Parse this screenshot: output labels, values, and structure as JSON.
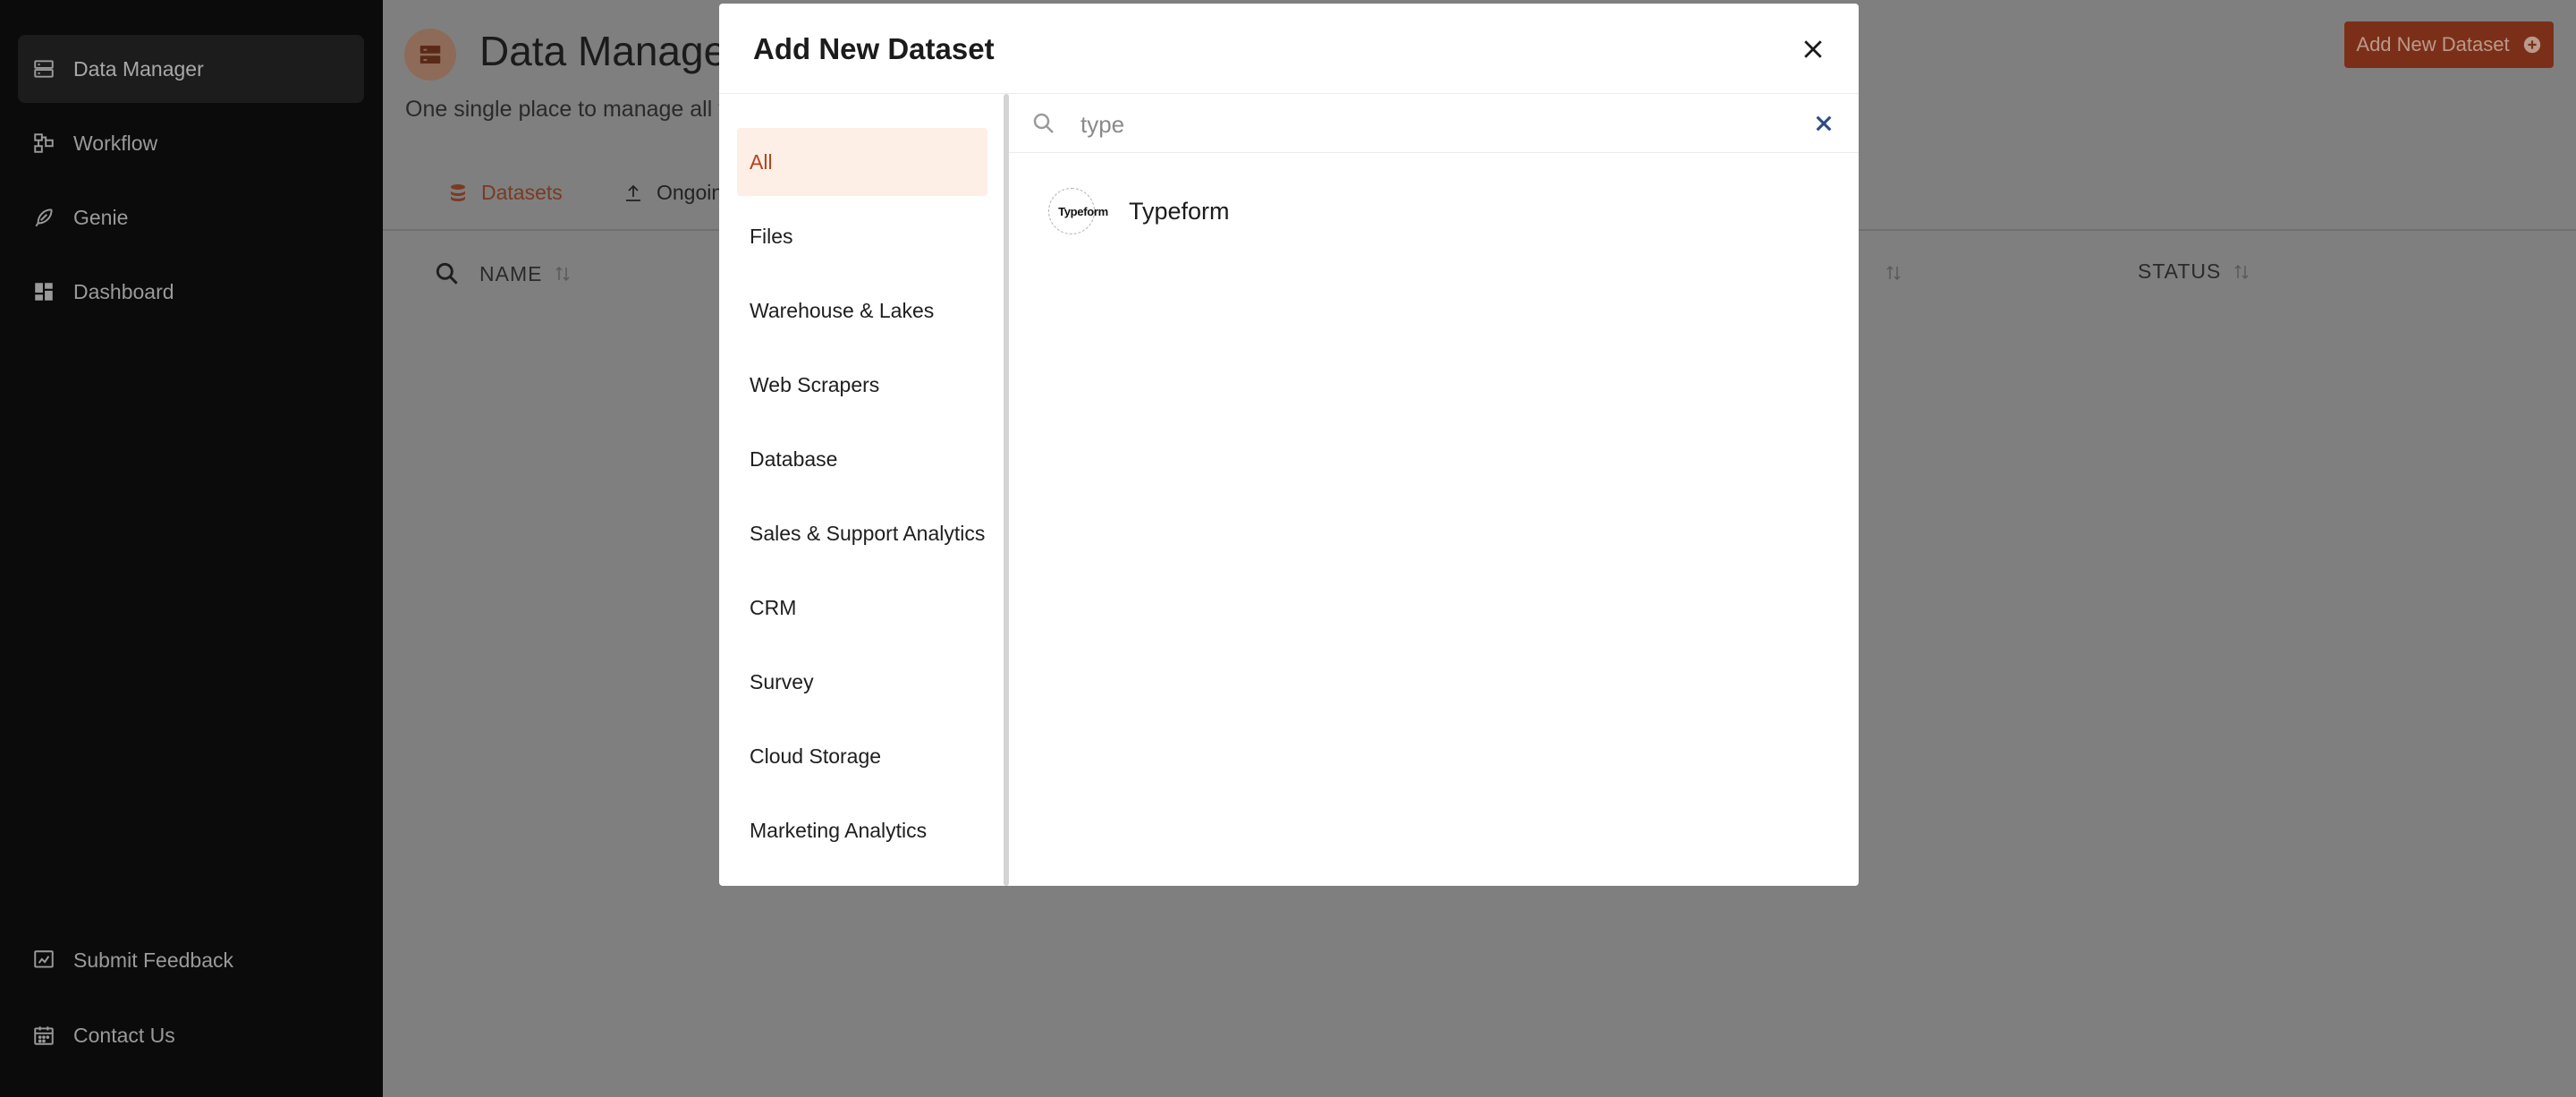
{
  "sidebar": {
    "items": [
      {
        "label": "Data Manager",
        "icon": "database-icon",
        "active": true
      },
      {
        "label": "Workflow",
        "icon": "workflow-icon"
      },
      {
        "label": "Genie",
        "icon": "feather-icon"
      },
      {
        "label": "Dashboard",
        "icon": "dashboard-icon"
      }
    ],
    "footer": [
      {
        "label": "Submit Feedback",
        "icon": "feedback-icon"
      },
      {
        "label": "Contact Us",
        "icon": "calendar-icon"
      }
    ]
  },
  "header": {
    "title": "Data Manage",
    "subtitle": "One single place to manage all t",
    "add_button": "Add New Dataset"
  },
  "tabs": [
    {
      "label": "Datasets",
      "active": true
    },
    {
      "label": "Ongoin"
    }
  ],
  "table": {
    "columns": [
      "NAME",
      "STATUS"
    ]
  },
  "modal": {
    "title": "Add New Dataset",
    "categories": [
      "All",
      "Files",
      "Warehouse & Lakes",
      "Web Scrapers",
      "Database",
      "Sales & Support Analytics",
      "CRM",
      "Survey",
      "Cloud Storage",
      "Marketing Analytics"
    ],
    "active_category": "All",
    "search": {
      "value": "",
      "placeholder": "type"
    },
    "results": [
      {
        "name": "Typeform",
        "logo_text": "Typeform"
      }
    ]
  },
  "colors": {
    "accent": "#b3441d",
    "accent_bg": "#fdeee6",
    "sidebar_bg": "#0b0b0b",
    "clear_x": "#2b4a86"
  }
}
